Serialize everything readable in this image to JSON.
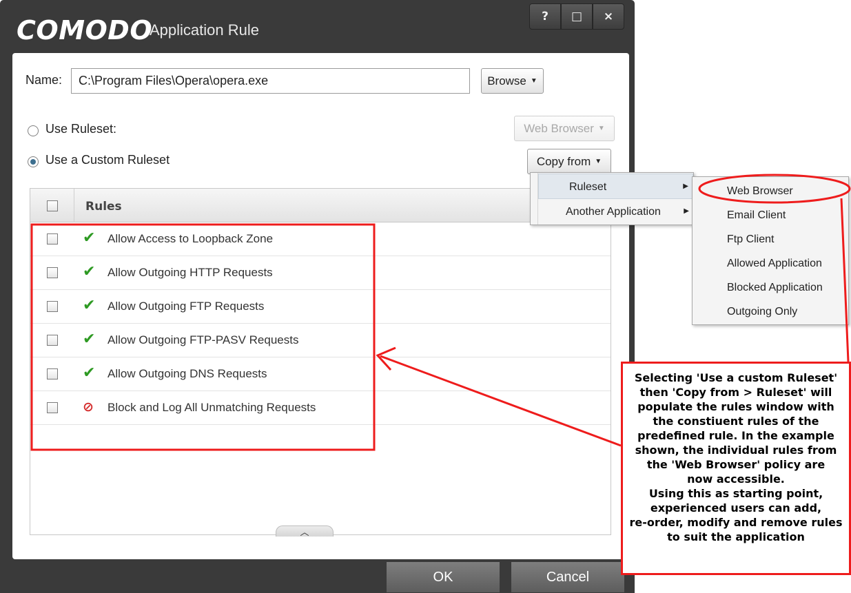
{
  "window": {
    "logo": "COMODO",
    "title": "Application Rule",
    "buttons": {
      "help": "?",
      "maximize": "□",
      "close": "×"
    }
  },
  "name": {
    "label": "Name:",
    "value": "C:\\Program Files\\Opera\\opera.exe",
    "browse_label": "Browse"
  },
  "options": {
    "use_ruleset_label": "Use Ruleset:",
    "use_ruleset_selected": false,
    "ruleset_value": "Web Browser",
    "use_custom_label": "Use a Custom Ruleset",
    "use_custom_selected": true,
    "copy_from_label": "Copy from"
  },
  "rules": {
    "header": "Rules",
    "items": [
      {
        "label": "Allow Access to Loopback Zone",
        "icon": "allow-check-icon"
      },
      {
        "label": "Allow Outgoing HTTP Requests",
        "icon": "allow-check-icon"
      },
      {
        "label": "Allow Outgoing FTP Requests",
        "icon": "allow-check-icon"
      },
      {
        "label": "Allow Outgoing FTP-PASV Requests",
        "icon": "allow-check-icon"
      },
      {
        "label": "Allow Outgoing DNS Requests",
        "icon": "allow-check-icon"
      },
      {
        "label": "Block and Log All Unmatching Requests",
        "icon": "block-log-icon"
      }
    ]
  },
  "copy_menu": {
    "items": [
      "Ruleset",
      "Another Application"
    ]
  },
  "ruleset_submenu": {
    "items": [
      "Web Browser",
      "Email Client",
      "Ftp Client",
      "Allowed Application",
      "Blocked Application",
      "Outgoing Only"
    ]
  },
  "footer": {
    "ok_label": "OK",
    "cancel_label": "Cancel"
  },
  "annotation": {
    "lines": [
      "Selecting 'Use a custom Ruleset'",
      "then 'Copy from > Ruleset' will",
      "populate the rules window with",
      "the constiuent rules of the",
      "predefined rule. In the example",
      "shown, the individual rules from",
      "the 'Web Browser' policy are",
      "now accessible.",
      "Using this as starting point,",
      "experienced users can add,",
      "re-order, modify and remove rules",
      "to suit the application"
    ],
    "color": "#ee1c1c"
  },
  "colors": {
    "window_bg": "#3a3a3a",
    "allow_icon": "#2e9a23",
    "block_icon": "#d42a2a",
    "highlight": "#ee1c1c"
  }
}
